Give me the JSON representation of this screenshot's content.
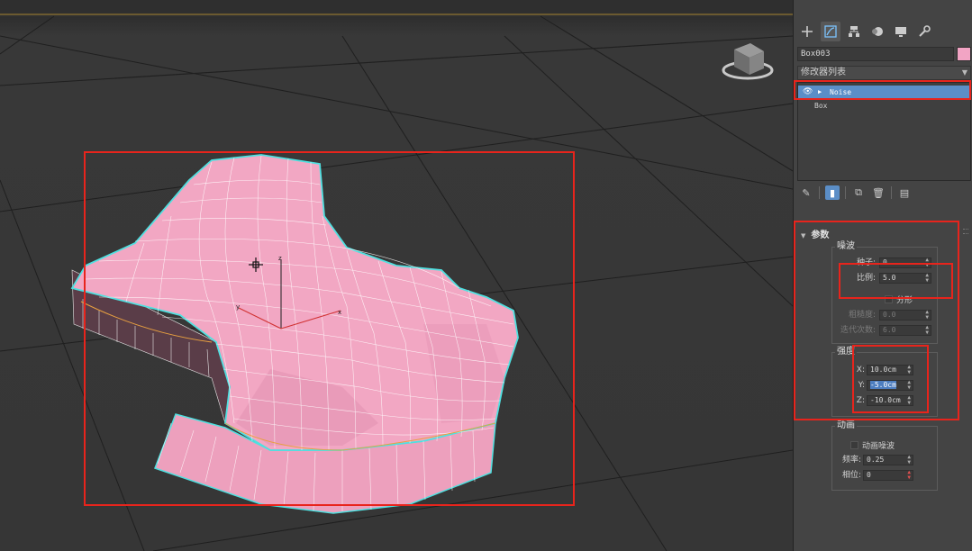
{
  "panel": {
    "tabs": [
      {
        "icon": "plus-icon",
        "label": "Create"
      },
      {
        "icon": "modify-icon",
        "label": "Modify"
      },
      {
        "icon": "hierarchy-icon",
        "label": "Hierarchy"
      },
      {
        "icon": "motion-icon",
        "label": "Motion"
      },
      {
        "icon": "display-icon",
        "label": "Display"
      },
      {
        "icon": "wrench-icon",
        "label": "Utilities"
      }
    ],
    "object_name": "Box003",
    "object_color": "#f2a4c4",
    "modifier_list_label": "修改器列表",
    "stack": [
      {
        "label": "Noise",
        "selected": true
      },
      {
        "label": "Box",
        "selected": false
      }
    ],
    "rollout_title": "参数",
    "noise_group": {
      "title": "噪波",
      "seed_label": "种子:",
      "seed_value": "0",
      "scale_label": "比例:",
      "scale_value": "5.0",
      "fractal_label": "分形",
      "roughness_label": "粗糙度:",
      "roughness_value": "0.0",
      "iterations_label": "迭代次数:",
      "iterations_value": "6.0"
    },
    "strength_group": {
      "title": "强度",
      "x_label": "X:",
      "x_value": "10.0cm",
      "y_label": "Y:",
      "y_value": "-5.0cm",
      "z_label": "Z:",
      "z_value": "-10.0cm"
    },
    "animation_group": {
      "title": "动画",
      "animate_label": "动画噪波",
      "frequency_label": "频率:",
      "frequency_value": "0.25",
      "phase_label": "相位:",
      "phase_value": "0"
    }
  },
  "colors": {
    "mesh_fill": "#f2a7c3",
    "selection_outline": "#4fe0e0",
    "annotation_red": "#e8241c",
    "stack_selected": "#5b8ec7"
  }
}
